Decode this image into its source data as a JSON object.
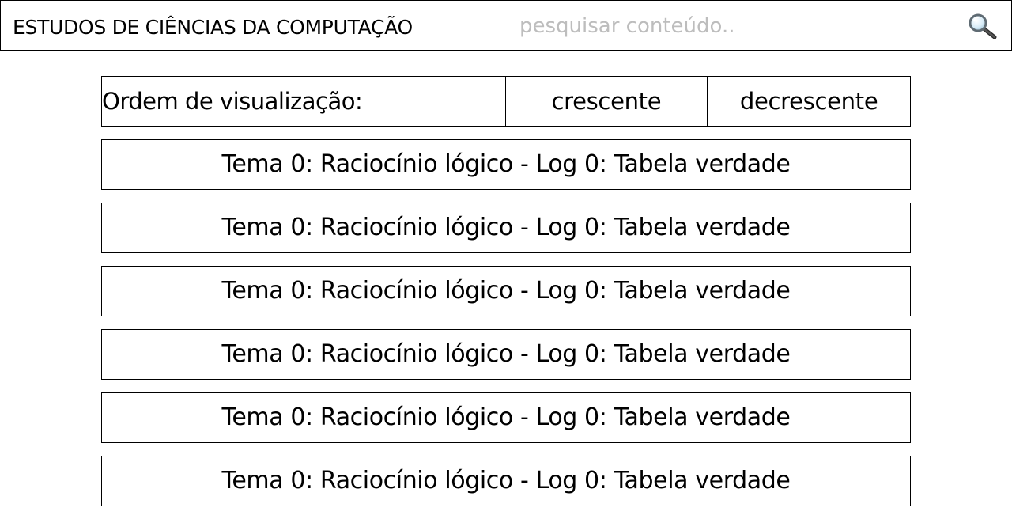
{
  "header": {
    "title": "ESTUDOS DE CIÊNCIAS DA COMPUTAÇÃO",
    "search_placeholder": "pesquisar conteúdo..",
    "search_value": "",
    "search_icon": "magnifying-glass"
  },
  "order": {
    "label": "Ordem de visualização:",
    "ascending": "crescente",
    "descending": "decrescente"
  },
  "topics": [
    {
      "label": "Tema 0: Raciocínio lógico - Log 0: Tabela verdade"
    },
    {
      "label": "Tema 0: Raciocínio lógico - Log 0: Tabela verdade"
    },
    {
      "label": "Tema 0: Raciocínio lógico - Log 0: Tabela verdade"
    },
    {
      "label": "Tema 0: Raciocínio lógico - Log 0: Tabela verdade"
    },
    {
      "label": "Tema 0: Raciocínio lógico - Log 0: Tabela verdade"
    },
    {
      "label": "Tema 0: Raciocínio lógico - Log 0: Tabela verdade"
    }
  ]
}
